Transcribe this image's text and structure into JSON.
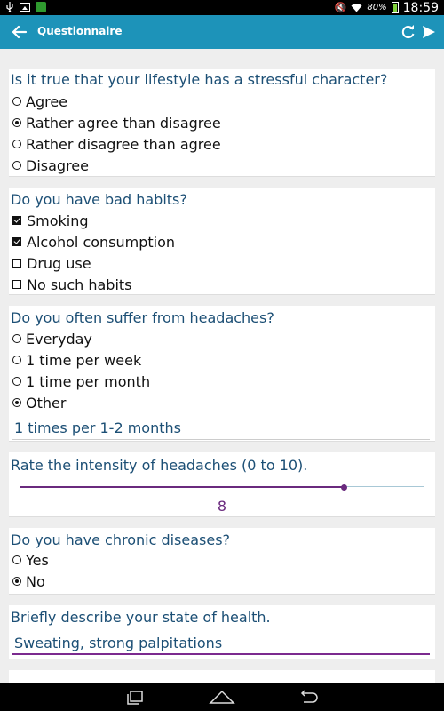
{
  "status_bar": {
    "battery": "80%",
    "time": "18:59",
    "icons": [
      "usb-icon",
      "picture-icon",
      "app-notification-icon",
      "mute-icon",
      "wifi-icon",
      "battery-icon"
    ]
  },
  "app_bar": {
    "title": "Questionnaire",
    "icons": [
      "back-arrow-icon",
      "refresh-icon",
      "send-icon"
    ],
    "color": "#1d93b9"
  },
  "questions": {
    "q1": {
      "text": "Is it true that your lifestyle has a stressful character?",
      "options": [
        {
          "label": "Agree",
          "selected": false
        },
        {
          "label": "Rather agree than disagree",
          "selected": true
        },
        {
          "label": "Rather disagree than agree",
          "selected": false
        },
        {
          "label": "Disagree",
          "selected": false
        }
      ]
    },
    "q2": {
      "text": "Do you have bad habits?",
      "options": [
        {
          "label": "Smoking",
          "checked": true
        },
        {
          "label": "Alcohol consumption",
          "checked": true
        },
        {
          "label": "Drug use",
          "checked": false
        },
        {
          "label": "No such habits",
          "checked": false
        }
      ]
    },
    "q3": {
      "text": "Do you often suffer from headaches?",
      "options": [
        {
          "label": "Everyday",
          "selected": false
        },
        {
          "label": "1 time per week",
          "selected": false
        },
        {
          "label": "1 time per month",
          "selected": false
        },
        {
          "label": "Other",
          "selected": true
        }
      ],
      "other_value": "1 times per 1-2 months"
    },
    "q4": {
      "text": "Rate the intensity of headaches (0 to 10).",
      "min": 0,
      "max": 10,
      "value": 8,
      "value_label": "8"
    },
    "q5": {
      "text": "Do you have chronic diseases?",
      "options": [
        {
          "label": "Yes",
          "selected": false
        },
        {
          "label": "No",
          "selected": true
        }
      ]
    },
    "q6": {
      "text": "Briefly describe your state of health.",
      "answer": "Sweating, strong palpitations"
    }
  },
  "colors": {
    "question_text": "#1c4f75",
    "accent": "#6a2a7e"
  },
  "nav_bar": {
    "icons": [
      "recent-apps-icon",
      "home-icon",
      "back-icon"
    ]
  }
}
